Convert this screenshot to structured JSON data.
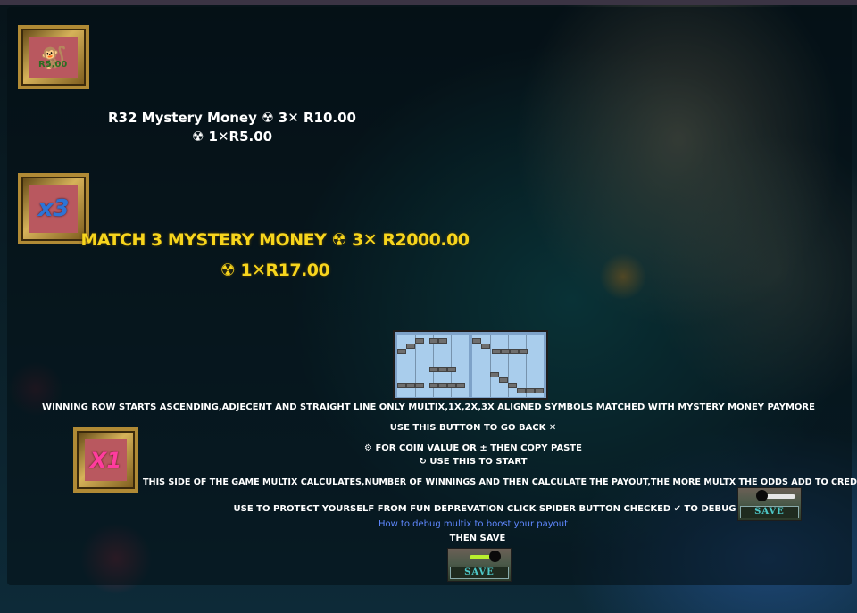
{
  "game": {
    "mystery_title": "R32 Mystery Money ☢ 3✕ R10.00",
    "mystery_line2": "☢ 1✕R5.00",
    "money_icon_text": "R5.00",
    "x3_badge": "x3",
    "x1_badge": "X1",
    "match3_line1": "MATCH 3 MYSTERY MONEY ☢ 3✕ R2000.00",
    "match3_line2": "☢ 1✕R17.00"
  },
  "instructions": {
    "winning_row": "WINNING ROW STARTS ASCENDING,ADJECENT AND STRAIGHT LINE ONLY MULTIX,1X,2X,3X ALIGNED SYMBOLS MATCHED WITH MYSTERY MONEY PAYMORE",
    "go_back": "USE THIS BUTTON TO GO BACK ✕",
    "coin_value": "⚙ FOR COIN VALUE OR ± THEN COPY PASTE",
    "start": "↻ USE THIS TO START",
    "multix_calc": "THIS SIDE OF THE GAME MULTIX CALCULATES,NUMBER OF WINNINGS AND THEN CALCULATE THE PAYOUT,THE MORE MULTX THE ODDS ADD TO CREDIT",
    "protect": "USE TO PROTECT YOURSELF FROM FUN DEPREVATION CLICK SPIDER BUTTON CHECKED ✔ TO DEBUG",
    "debug_link": "How to debug multix to boost your payout",
    "then_save": "THEN SAVE"
  },
  "buttons": {
    "save_label_1": "SAVE",
    "save_label_2": "SAVE"
  },
  "colors": {
    "yellow_text": "#f7d51d",
    "link": "#5f88ff",
    "frame_gold": "#b08a35"
  }
}
